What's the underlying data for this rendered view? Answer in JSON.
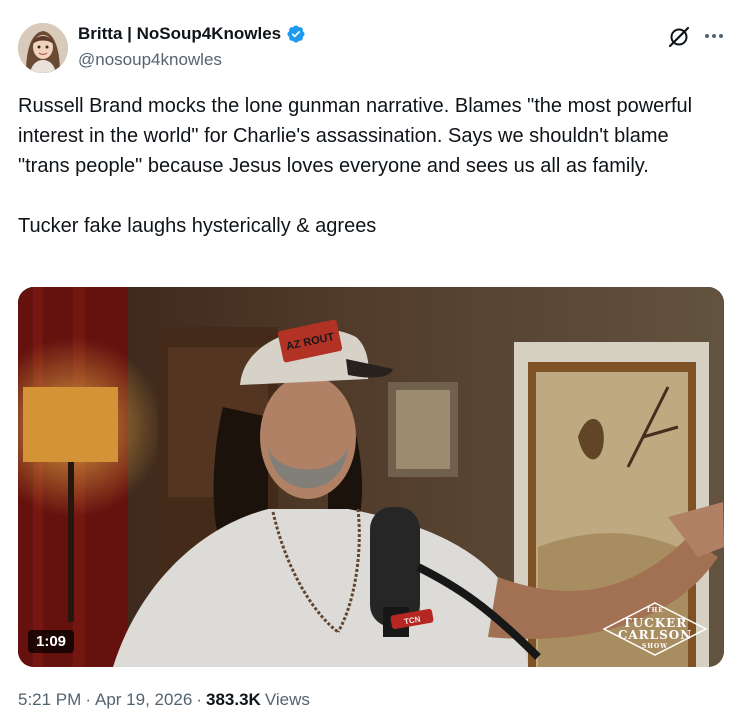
{
  "author": {
    "display_name": "Britta | NoSoup4Knowles",
    "handle": "@nosoup4knowles",
    "verified": true,
    "verified_color": "#1d9bf0"
  },
  "header": {
    "grok_icon": "grok-slash-icon",
    "more_icon": "more-horizontal-icon"
  },
  "tweet": {
    "text": "Russell Brand mocks the lone gunman narrative. Blames \"the most powerful interest in the world\" for Charlie's assassination. Says we shouldn't blame \"trans people\" because Jesus loves everyone and sees us all as family.\n\nTucker fake laughs hysterically & agrees"
  },
  "media": {
    "type": "video",
    "duration": "1:09",
    "cap_text": "AZ ROUT",
    "mic_label": "TCN",
    "logo": {
      "top": "THE",
      "line1": "TUCKER",
      "line2": "CARLSON",
      "bottom": "SHOW"
    }
  },
  "meta": {
    "time": "5:21 PM",
    "separator": "·",
    "date": "Apr 19, 2026",
    "views_count": "383.3K",
    "views_label": "Views"
  }
}
